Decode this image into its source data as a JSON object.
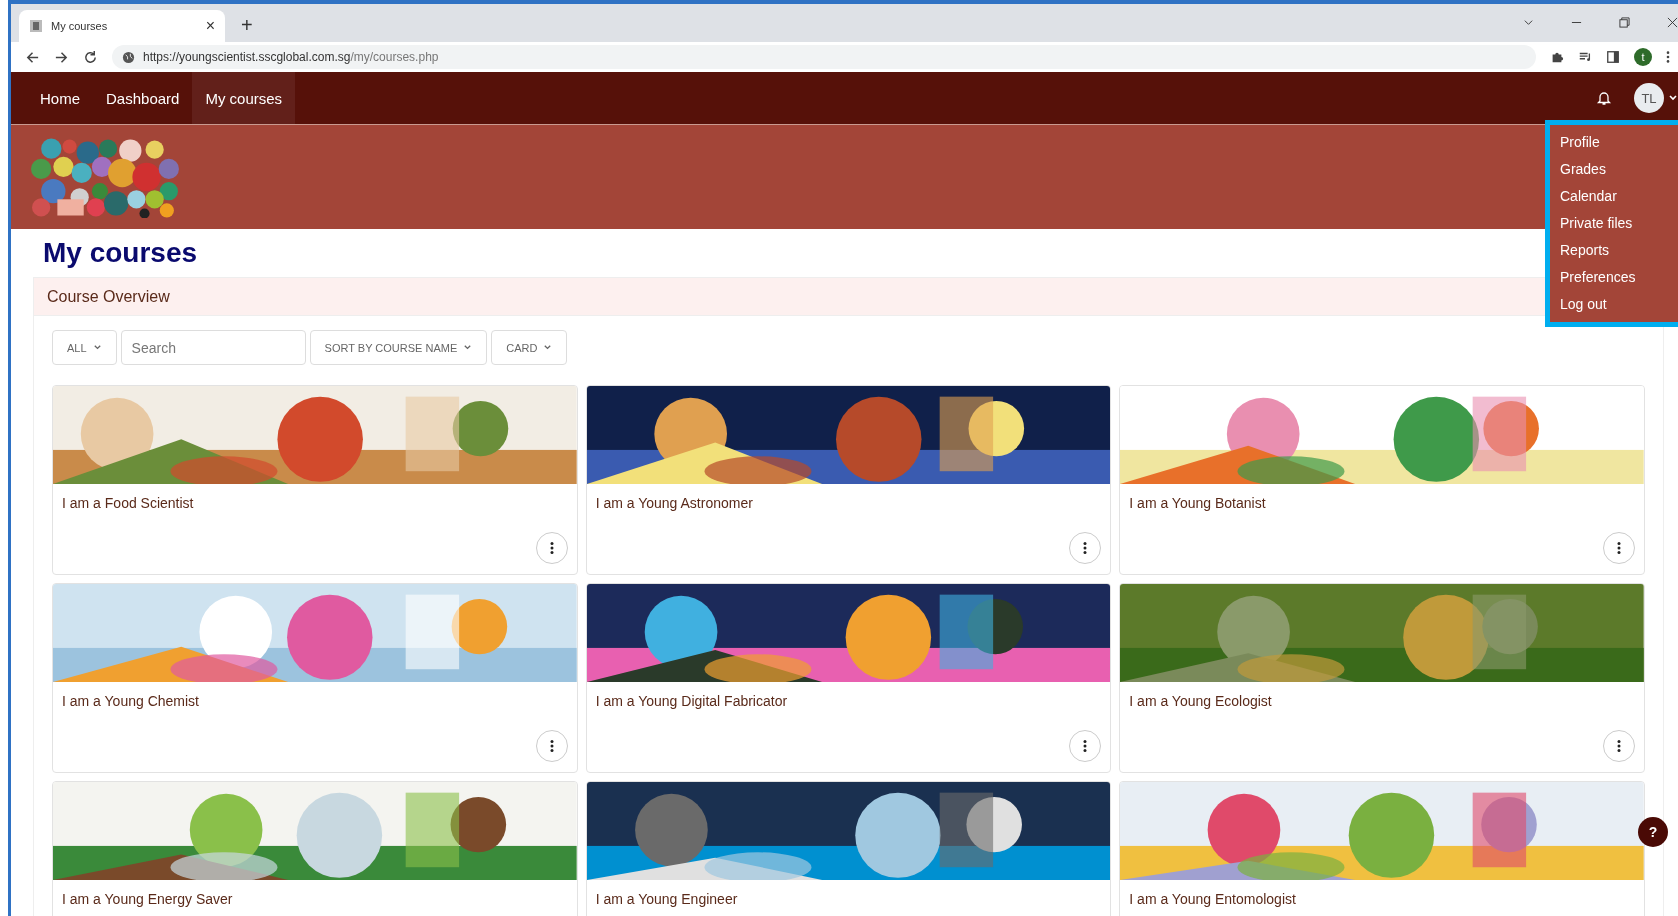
{
  "browser": {
    "tab_title": "My courses",
    "tab_close": "×",
    "new_tab": "+",
    "url_host": "https://youngscientist.sscglobal.com.sg",
    "url_path": "/my/courses.php",
    "profile_initial": "t"
  },
  "navbar": {
    "items": [
      {
        "label": "Home",
        "selected": false
      },
      {
        "label": "Dashboard",
        "selected": false
      },
      {
        "label": "My courses",
        "selected": true
      }
    ],
    "avatar": "TL"
  },
  "user_menu": {
    "items": [
      "Profile",
      "Grades",
      "Calendar",
      "Private files",
      "Reports",
      "Preferences",
      "Log out"
    ]
  },
  "page_title": "My courses",
  "course_overview": {
    "heading": "Course Overview",
    "filters": [
      {
        "kind": "dropdown",
        "label": "ALL"
      },
      {
        "kind": "search",
        "placeholder": "Search"
      },
      {
        "kind": "dropdown",
        "label": "SORT BY COURSE NAME"
      },
      {
        "kind": "dropdown",
        "label": "CARD"
      }
    ],
    "courses": [
      {
        "title": "I am a Food Scientist"
      },
      {
        "title": "I am a Young Astronomer"
      },
      {
        "title": "I am a Young Botanist"
      },
      {
        "title": "I am a Young Chemist"
      },
      {
        "title": "I am a Young Digital Fabricator"
      },
      {
        "title": "I am a Young Ecologist"
      },
      {
        "title": "I am a Young Energy Saver"
      },
      {
        "title": "I am a Young Engineer"
      },
      {
        "title": "I am a Young Entomologist"
      }
    ]
  },
  "help_button": "?"
}
